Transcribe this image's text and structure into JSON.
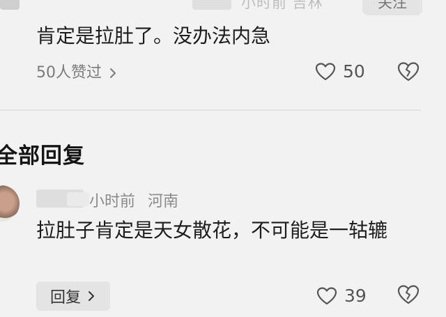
{
  "top_row": {
    "meta_text": "小时前 吉林",
    "follow_label": "关注"
  },
  "comment1": {
    "text": "肯定是拉肚了。没办法内急",
    "liked_by": "50人赞过",
    "like_count": "50"
  },
  "section": {
    "title": "全部回复"
  },
  "comment2": {
    "time": "小时前",
    "location": "河南",
    "text": "拉肚子肯定是天女散花，不可能是一轱辘",
    "reply_label": "回复",
    "like_count": "39"
  },
  "icons": {
    "like": "heart-icon",
    "dislike": "broken-heart-icon",
    "chevron": "chevron-right-icon"
  },
  "colors": {
    "background": "#f2f2f2",
    "text_primary": "#1d1d1d",
    "text_secondary": "#8a8a8a",
    "button_bg": "#e4e4e4"
  }
}
